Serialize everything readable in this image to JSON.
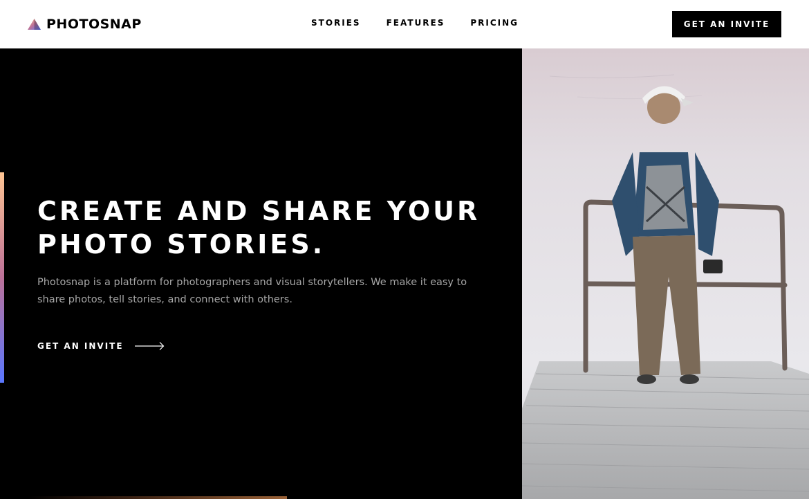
{
  "brand": {
    "name": "PHOTOSNAP",
    "gradient": [
      "#ffc593",
      "#bc7198",
      "#5a77ff"
    ]
  },
  "nav": {
    "items": [
      "STORIES",
      "FEATURES",
      "PRICING"
    ]
  },
  "header": {
    "cta_label": "GET AN INVITE"
  },
  "hero": {
    "title_line1": "CREATE AND SHARE YOUR",
    "title_line2": "PHOTO STORIES.",
    "description": "Photosnap is a platform for photographers and visual storytellers. We make it easy to share photos, tell stories, and connect with others.",
    "cta_label": "GET AN INVITE",
    "cta_icon": "arrow-right-icon"
  },
  "colors": {
    "dark": "#000000",
    "light": "#ffffff",
    "muted_text": "#a7a7a7"
  }
}
